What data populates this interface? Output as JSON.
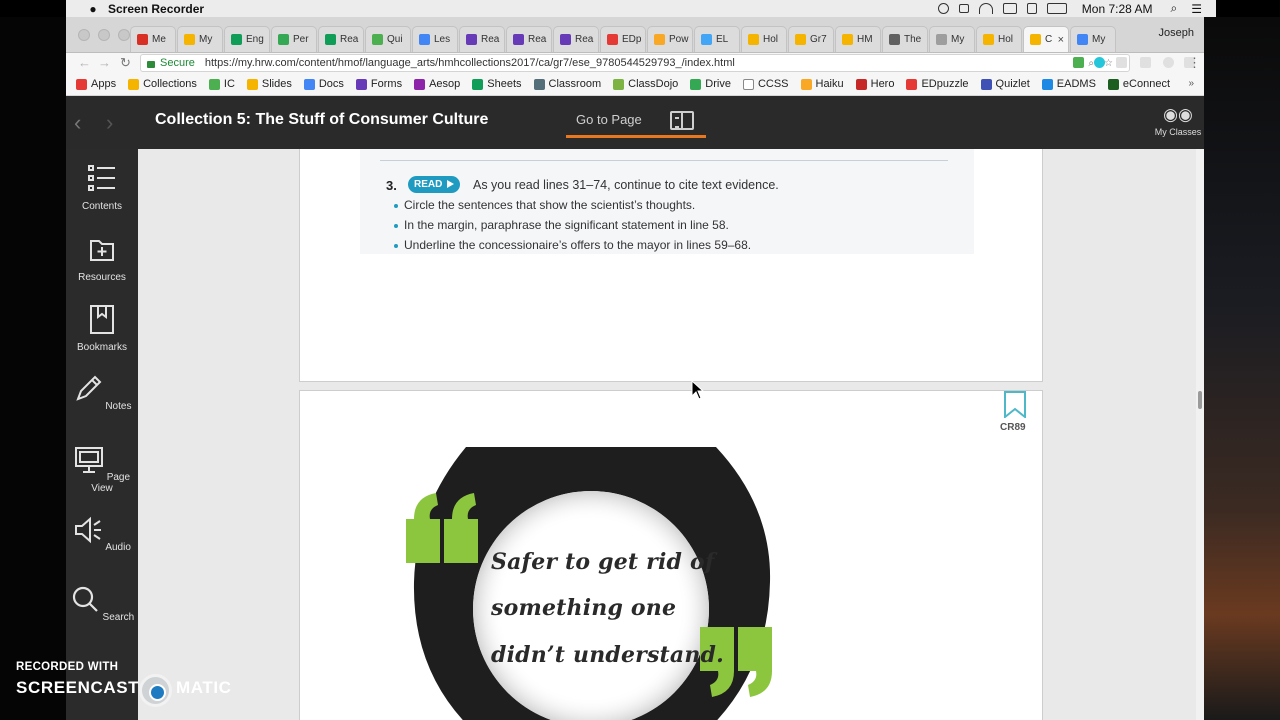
{
  "menubar": {
    "app_name": "Screen Recorder",
    "clock": "Mon 7:28 AM"
  },
  "tabs": [
    {
      "label": "Me",
      "color": "#d93025"
    },
    {
      "label": "My",
      "color": "#f4b400"
    },
    {
      "label": "Eng",
      "color": "#0f9d58"
    },
    {
      "label": "Per",
      "color": "#34a853"
    },
    {
      "label": "Rea",
      "color": "#0f9d58"
    },
    {
      "label": "Qui",
      "color": "#4caf50"
    },
    {
      "label": "Les",
      "color": "#4285f4"
    },
    {
      "label": "Rea",
      "color": "#673ab7"
    },
    {
      "label": "Rea",
      "color": "#673ab7"
    },
    {
      "label": "Rea",
      "color": "#673ab7"
    },
    {
      "label": "EDp",
      "color": "#e53935"
    },
    {
      "label": "Pow",
      "color": "#f9a825"
    },
    {
      "label": "EL",
      "color": "#42a5f5"
    },
    {
      "label": "Hol",
      "color": "#f4b400"
    },
    {
      "label": "Gr7",
      "color": "#f4b400"
    },
    {
      "label": "HM",
      "color": "#f4b400"
    },
    {
      "label": "The",
      "color": "#616161"
    },
    {
      "label": "My",
      "color": "#9e9e9e"
    },
    {
      "label": "Hol",
      "color": "#f4b400"
    },
    {
      "label": "C",
      "color": "#f4b400",
      "active": true
    },
    {
      "label": "My",
      "color": "#4285f4"
    }
  ],
  "profile": "Joseph",
  "address": {
    "secure_label": "Secure",
    "url": "https://my.hrw.com/content/hmof/language_arts/hmhcollections2017/ca/gr7/ese_9780544529793_/index.html"
  },
  "bookmarks": [
    {
      "label": "Apps",
      "color": "#e53935"
    },
    {
      "label": "Collections",
      "color": "#f4b400"
    },
    {
      "label": "IC",
      "color": "#4caf50"
    },
    {
      "label": "Slides",
      "color": "#f4b400"
    },
    {
      "label": "Docs",
      "color": "#4285f4"
    },
    {
      "label": "Forms",
      "color": "#673ab7"
    },
    {
      "label": "Aesop",
      "color": "#8e24aa"
    },
    {
      "label": "Sheets",
      "color": "#0f9d58"
    },
    {
      "label": "Classroom",
      "color": "#546e7a"
    },
    {
      "label": "ClassDojo",
      "color": "#7cb342"
    },
    {
      "label": "Drive",
      "color": "#34a853"
    },
    {
      "label": "CCSS",
      "color": "#ffffff"
    },
    {
      "label": "Haiku",
      "color": "#f9a825"
    },
    {
      "label": "Hero",
      "color": "#c62828"
    },
    {
      "label": "EDpuzzle",
      "color": "#e53935"
    },
    {
      "label": "Quizlet",
      "color": "#3f51b5"
    },
    {
      "label": "EADMS",
      "color": "#1e88e5"
    },
    {
      "label": "eConnect",
      "color": "#1b5e20"
    }
  ],
  "header": {
    "title": "Collection 5: The Stuff of Consumer Culture",
    "goto_label": "Go to Page",
    "my_classes": "My Classes",
    "accent": "#e87722"
  },
  "sidebar": [
    {
      "label": "Contents",
      "icon": "contents-icon"
    },
    {
      "label": "Resources",
      "icon": "resources-icon"
    },
    {
      "label": "Bookmarks",
      "icon": "bookmark-icon"
    },
    {
      "label": "Notes",
      "icon": "pencil-icon"
    },
    {
      "label": "Page View",
      "icon": "monitor-icon"
    },
    {
      "label": "Audio",
      "icon": "speaker-icon"
    },
    {
      "label": "Search",
      "icon": "search-icon"
    }
  ],
  "page_a": {
    "number": "3.",
    "badge": "READ",
    "prompt": "As you read lines 31–74, continue to cite text evidence.",
    "bullets": [
      "Circle the sentences that show the scientist’s thoughts.",
      "In the margin, paraphrase the significant statement in line 58.",
      "Underline the concessionaire’s offers to the mayor in lines 59–68."
    ]
  },
  "page_b": {
    "code": "CR89",
    "quote_lines": [
      "Safer to get rid of",
      "something one",
      "didn’t understand."
    ],
    "quote_color": "#8cc63f"
  },
  "watermark": {
    "recorded_with": "RECORDED WITH",
    "brand_left": "SCREENCAST",
    "brand_right": "MATIC"
  }
}
